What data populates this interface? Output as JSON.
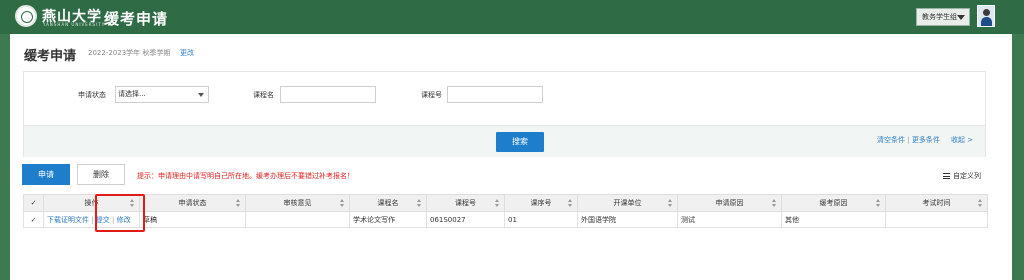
{
  "header": {
    "logo_cn": "燕山大学",
    "logo_en": "YANSHAN UNIVERSITY",
    "app_title": "缓考申请",
    "user_role": "教务学生组"
  },
  "page": {
    "title": "缓考申请",
    "term": "2022-2023学年 秋季学期",
    "change_link": "更改"
  },
  "search": {
    "status_label": "申请状态",
    "status_value": "请选择...",
    "course_name_label": "课程名",
    "course_no_label": "课程号",
    "search_button": "搜索",
    "clear": "清空条件",
    "more": "更多条件",
    "collapse": "收起 >"
  },
  "toolbar": {
    "apply_button": "申请",
    "delete_button": "删除",
    "hint": "提示：申请理由中请写明自己所在地。缓考办理后不要错过补考报名！",
    "custom_columns": "自定义列"
  },
  "table": {
    "check_all": "✓",
    "headers": [
      "操作",
      "申请状态",
      "审核意见",
      "课程名",
      "课程号",
      "课序号",
      "开课单位",
      "申请原因",
      "缓考原因",
      "考试时间"
    ],
    "rows": [
      {
        "check": "✓",
        "op_download": "下载证明文件",
        "op_submit": "提交",
        "op_edit": "修改",
        "status": "草稿",
        "review": "",
        "course_name": "学术论文写作",
        "course_no": "061S0027",
        "section_no": "01",
        "department": "外国语学院",
        "apply_reason": "测试",
        "defer_reason": "其他",
        "exam_time": ""
      }
    ]
  }
}
